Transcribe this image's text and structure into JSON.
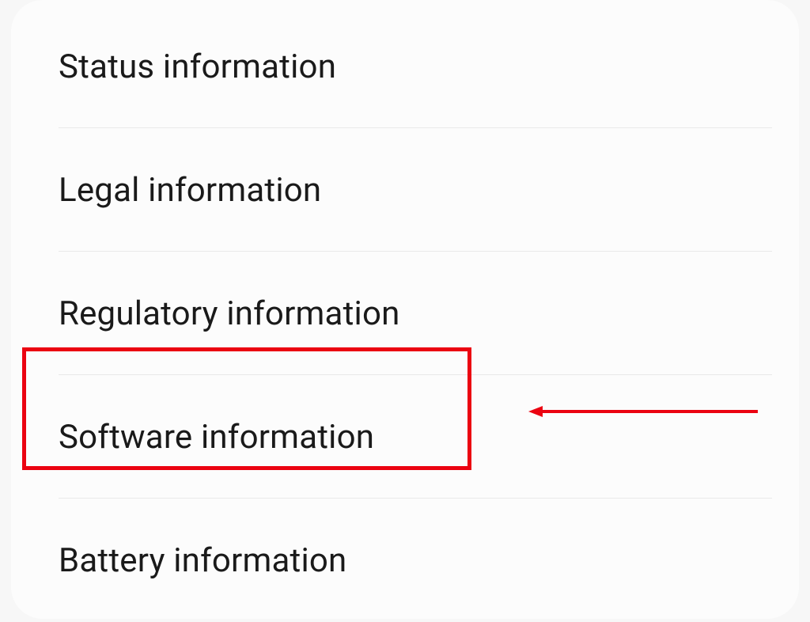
{
  "settings": {
    "items": [
      {
        "label": "Status information"
      },
      {
        "label": "Legal information"
      },
      {
        "label": "Regulatory information"
      },
      {
        "label": "Software information"
      },
      {
        "label": "Battery information"
      }
    ]
  },
  "annotation": {
    "highlight_color": "#eb0311",
    "highlighted_index": 3
  }
}
